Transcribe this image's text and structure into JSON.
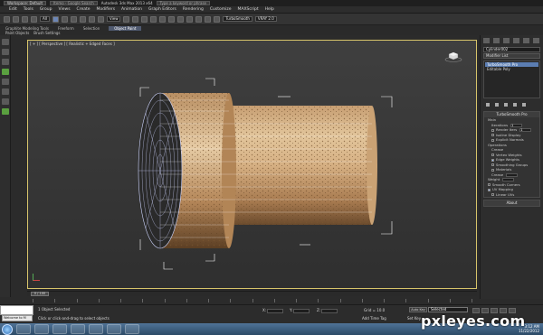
{
  "titlebar": {
    "workspace_label": "Workspace: Default",
    "tab_label": "Itemo - Google Search",
    "app_title": "Autodesk 3ds Max 2013 x64",
    "search_placeholder": "Type a keyword or phrase",
    "plugin_1": "TurboSmooth",
    "plugin_2": "VRAY 2.0"
  },
  "menubar": {
    "items": [
      "Edit",
      "Tools",
      "Group",
      "Views",
      "Create",
      "Modifiers",
      "Animation",
      "Graph Editors",
      "Rendering",
      "Customize",
      "MAXScript",
      "Help"
    ]
  },
  "toolbar": {
    "filter_value": "All",
    "view_value": "View"
  },
  "ribbon": {
    "tabs": [
      "Graphite Modeling Tools",
      "Freeform",
      "Selection",
      "Object Paint"
    ],
    "sub": [
      "Paint Objects",
      "Brush Settings"
    ]
  },
  "viewport": {
    "label": "[ + ] [ Perspective ] [ Realistic + Edged Faces ]"
  },
  "command_panel": {
    "object_name": "Cylinder002",
    "modifier_list": "Modifier List",
    "stack": [
      "TurboSmooth Pro",
      "Editable Poly"
    ],
    "rollout_title": "TurboSmooth Pro",
    "main_label": "Main",
    "iterations_label": "Iterations",
    "iterations_value": "1",
    "render_iters_label": "Render Iters",
    "render_iters_value": "1",
    "isoline_label": "Isoline Display",
    "explicit_normals_label": "Explicit Normals",
    "operations_label": "Operations",
    "crease_label": "Crease",
    "vertex_weights_label": "Vertex Weights",
    "edge_weights_label": "Edge Weights",
    "smoothing_groups_label": "Smoothing Groups",
    "materials_label": "Materials",
    "crease_value_label": "Crease",
    "weight_label": "Weight",
    "smooth_corners_label": "Smooth Corners",
    "uv_mapping_label": "UV Mapping",
    "linear_uvs_label": "Linear UVs",
    "about_label": "About"
  },
  "timeline": {
    "frame_label": "0 / 100"
  },
  "status": {
    "selected": "1 Object Selected",
    "help": "Click or click-and-drag to select objects",
    "grid": "Grid = 10.0",
    "add_time_tag": "Add Time Tag",
    "auto_key": "Auto Key",
    "set_key": "Set Key",
    "selected_dd": "Selected",
    "maxscript_text": "Welcome to M",
    "x_label": "X:",
    "y_label": "Y:",
    "z_label": "Z:"
  },
  "taskbar": {
    "time": "3:12 AM",
    "date": "11/22/2012"
  },
  "watermark": {
    "text": "pxleyes",
    "suffix": ".com"
  },
  "colors": {
    "viewport_border": "#d7c46a",
    "selection_blue": "#5b7db1",
    "cork": "#d9b88f"
  }
}
